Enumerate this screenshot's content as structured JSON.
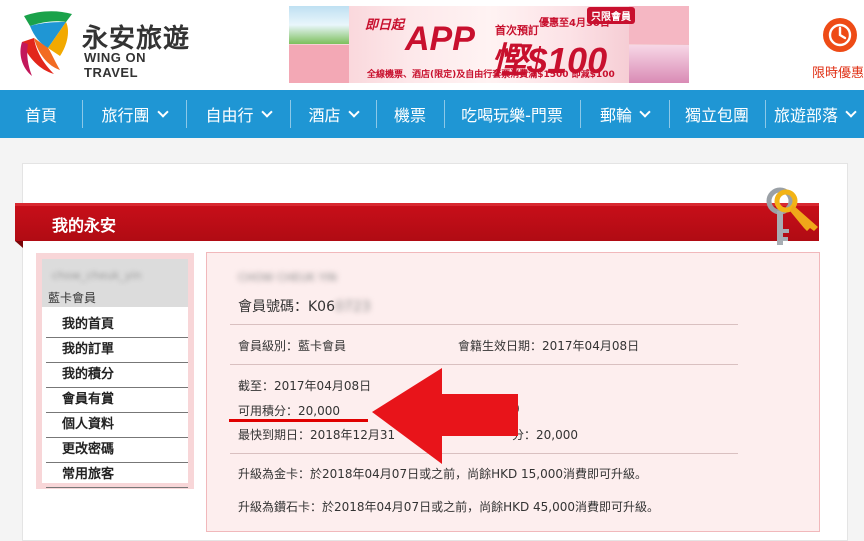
{
  "header": {
    "logo_cn": "永安旅遊",
    "logo_en": "WING ON TRAVEL",
    "banner": {
      "top_text": "即日起",
      "app_text": "APP",
      "mid_text": "首次預訂",
      "discount_text": "慳$100",
      "right_text": "優惠至4月30日",
      "tag_text": "只限會員",
      "bottom_text": "全線機票、酒店(限定)及自由行套票消費滿$1500 即減$100"
    },
    "promo_label": "限時優惠"
  },
  "nav": {
    "items": [
      {
        "label": "首頁",
        "has_dropdown": false
      },
      {
        "label": "旅行團",
        "has_dropdown": true
      },
      {
        "label": "自由行",
        "has_dropdown": true
      },
      {
        "label": "酒店",
        "has_dropdown": true
      },
      {
        "label": "機票",
        "has_dropdown": false
      },
      {
        "label": "吃喝玩樂-門票",
        "has_dropdown": false
      },
      {
        "label": "郵輪",
        "has_dropdown": true
      },
      {
        "label": "獨立包團",
        "has_dropdown": false
      },
      {
        "label": "旅遊部落",
        "has_dropdown": true
      }
    ]
  },
  "page_title": "我的永安",
  "sidebar": {
    "username": "chow_cheuk_yin",
    "level": "藍卡會員",
    "menu": [
      "我的首頁",
      "我的訂單",
      "我的積分",
      "會員有賞",
      "個人資料",
      "更改密碼",
      "常用旅客"
    ]
  },
  "member": {
    "name": "CHOW CHEUK YIN",
    "id_label": "會員號碼：",
    "id_visible": "K06",
    "id_hidden": "0723",
    "level_label": "會員級別：",
    "level_value": "藍卡會員",
    "effective_label": "會籍生效日期：",
    "effective_value": "2017年04月08日",
    "as_of_label": "截至：",
    "as_of_value": "2017年04月08日",
    "points_label": "可用積分：",
    "points_value": "20,000",
    "hidden_right_value": "0",
    "expiry_label": "最快到期日：",
    "expiry_value": "2018年12月31",
    "hidden_right_label_tail": "分：",
    "hidden_right_value2": "20,000",
    "upgrade_gold": "升級為金卡：於2018年04月07日或之前，尚餘HKD 15,000消費即可升級。",
    "upgrade_diamond": "升級為鑽石卡：於2018年04月07日或之前，尚餘HKD 45,000消費即可升級。"
  },
  "icons": {
    "logo": "wing-on-logo-icon",
    "promo": "gift-icon",
    "keys": "keys-icon",
    "arrow": "red-arrow-icon"
  },
  "colors": {
    "nav": "#1f96d4",
    "title_bar": "#c90f1a",
    "info_bg": "#fdeeee",
    "sidebar_border": "#f8d6d8",
    "accent_red": "#e00000"
  }
}
